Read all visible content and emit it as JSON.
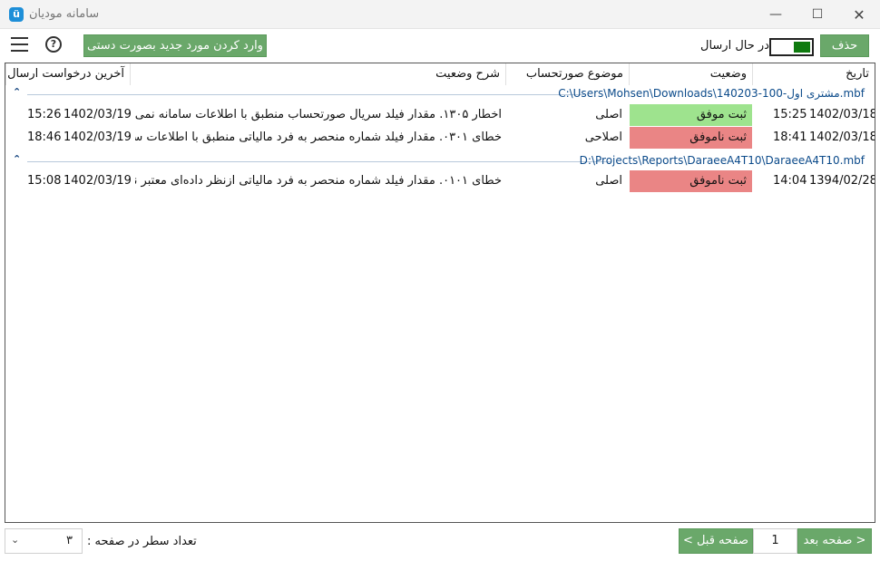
{
  "window": {
    "title": "سامانه مودیان",
    "app_icon": "ü",
    "minimize_glyph": "—",
    "maximize_glyph": "☐",
    "close_glyph": "✕"
  },
  "toolbar": {
    "menu_icon": "hamburger-icon",
    "help_icon": "help-icon",
    "help_glyph": "?",
    "manual_entry_label": "وارد کردن مورد جدید بصورت دستی",
    "sending_toggle_label": "در حال ارسال",
    "sending_toggle_on": true,
    "delete_label": "حذف"
  },
  "table": {
    "headers": {
      "date": "تاریخ",
      "status": "وضعیت",
      "invoice_subject": "موضوع صورتحساب",
      "status_description": "شرح وضعیت",
      "last_request": "آخرین درخواست ارسال"
    },
    "groups": [
      {
        "path": "C:\\Users\\Mohsen\\Downloads\\140203-100-مشتری اول.mbf",
        "rows": [
          {
            "date": "1402/03/18",
            "time": "15:25",
            "status": "ثبت موفق",
            "status_kind": "success",
            "subject": "اصلی",
            "description": "اخطار ۱۳۰۵. مقدار فیلد سریال صورتحساب منطبق با اطلاعات سامانه نمی‌با...",
            "last_date": "1402/03/19",
            "last_time": "15:26"
          },
          {
            "date": "1402/03/18",
            "time": "18:41",
            "status": "ثبت ناموفق",
            "status_kind": "fail",
            "subject": "اصلاحی",
            "description": "خطای ۰۳۰۱. مقدار فیلد شماره منحصر به فرد مالیاتی منطبق با اطلاعات ساما...",
            "last_date": "1402/03/19",
            "last_time": "18:46"
          }
        ]
      },
      {
        "path": "D:\\Projects\\Reports\\DaraeeA4T10\\DaraeeA4T10.mbf",
        "rows": [
          {
            "date": "1394/02/28",
            "time": "14:04",
            "status": "ثبت ناموفق",
            "status_kind": "fail",
            "subject": "اصلی",
            "description": "خطای ۰۱۰۱. مقدار فیلد شماره منحصر به فرد مالیاتی ازنظر داده‌ای معتبر نبود...",
            "last_date": "1402/03/19",
            "last_time": "15:08"
          }
        ]
      }
    ]
  },
  "footer": {
    "rows_per_page_label": "تعداد سطر در صفحه :",
    "rows_per_page_value": "۳",
    "prev_page_label": "صفحه قبل >",
    "next_page_label": "< صفحه بعد",
    "page_number": "1"
  },
  "colors": {
    "success": "#9ee38e",
    "fail": "#ea8585",
    "button_green": "#6aa86a",
    "toggle_green": "#0f7a0f",
    "path_blue": "#0b4a8a"
  }
}
